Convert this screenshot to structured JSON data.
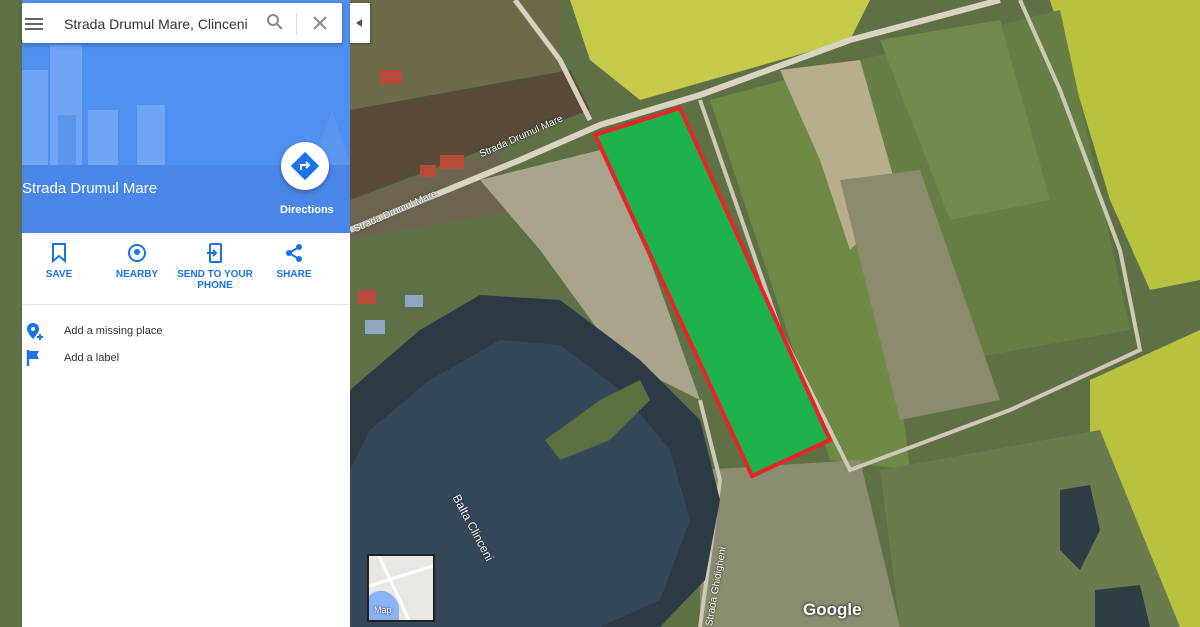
{
  "search": {
    "query": "Strada Drumul Mare, Clinceni"
  },
  "place": {
    "title": "Strada Drumul Mare",
    "directions_label": "Directions"
  },
  "actions": [
    {
      "label": "SAVE"
    },
    {
      "label": "NEARBY"
    },
    {
      "label": "SEND TO YOUR PHONE"
    },
    {
      "label": "SHARE"
    }
  ],
  "links": {
    "add_place": "Add a missing place",
    "add_label": "Add a label"
  },
  "map": {
    "road_labels": [
      "Strada Drumul Mare",
      "Strada Drumul Mare",
      "Strada Ghidigheni"
    ],
    "lake_label": "Balta Clinceni",
    "minimap_label": "Map",
    "attribution": "Google",
    "highlight_color": "#1db24a",
    "highlight_border": "#e8242a"
  }
}
